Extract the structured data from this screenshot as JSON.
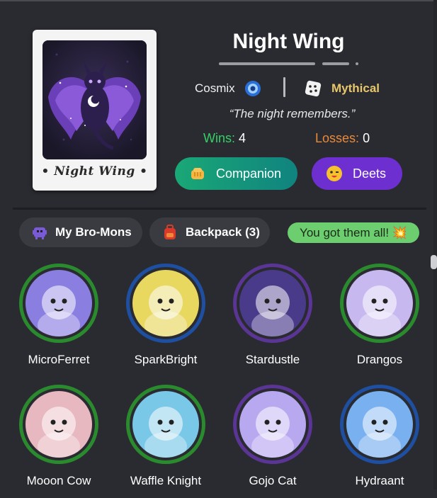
{
  "card": {
    "name_label": "• Night Wing •"
  },
  "header": {
    "title": "Night Wing",
    "creator": "Cosmix",
    "rarity": "Mythical",
    "quote": "“The night remembers.”",
    "wins_label": "Wins:",
    "wins_value": "4",
    "losses_label": "Losses:",
    "losses_value": "0"
  },
  "buttons": {
    "companion": "Companion",
    "deets": "Deets"
  },
  "tabs": {
    "bromons": "My Bro-Mons",
    "backpack": "Backpack (3)",
    "all_collected": "You got them all! 💥"
  },
  "mons": [
    {
      "name": "MicroFerret",
      "ring": "green",
      "bg": "#8a7ee0"
    },
    {
      "name": "SparkBright",
      "ring": "blue",
      "bg": "#e8d860"
    },
    {
      "name": "Stardustle",
      "ring": "purple",
      "bg": "#4a3a8a"
    },
    {
      "name": "Drangos",
      "ring": "green",
      "bg": "#c8b8f0"
    },
    {
      "name": "Mooon Cow",
      "ring": "green",
      "bg": "#e8b8c0"
    },
    {
      "name": "Waffle Knight",
      "ring": "green",
      "bg": "#7ac8e8"
    },
    {
      "name": "Gojo Cat",
      "ring": "purple",
      "bg": "#b8a8f0"
    },
    {
      "name": "Hydraant",
      "ring": "blue",
      "bg": "#78b0f0"
    }
  ],
  "colors": {
    "background": "#2a2b30",
    "wins": "#34d066",
    "losses": "#e88a3a",
    "rarity": "#e7c76a",
    "deets_button": "#6e2fd0",
    "companion_button": "#1aa876",
    "badge": "#6dce6f"
  }
}
